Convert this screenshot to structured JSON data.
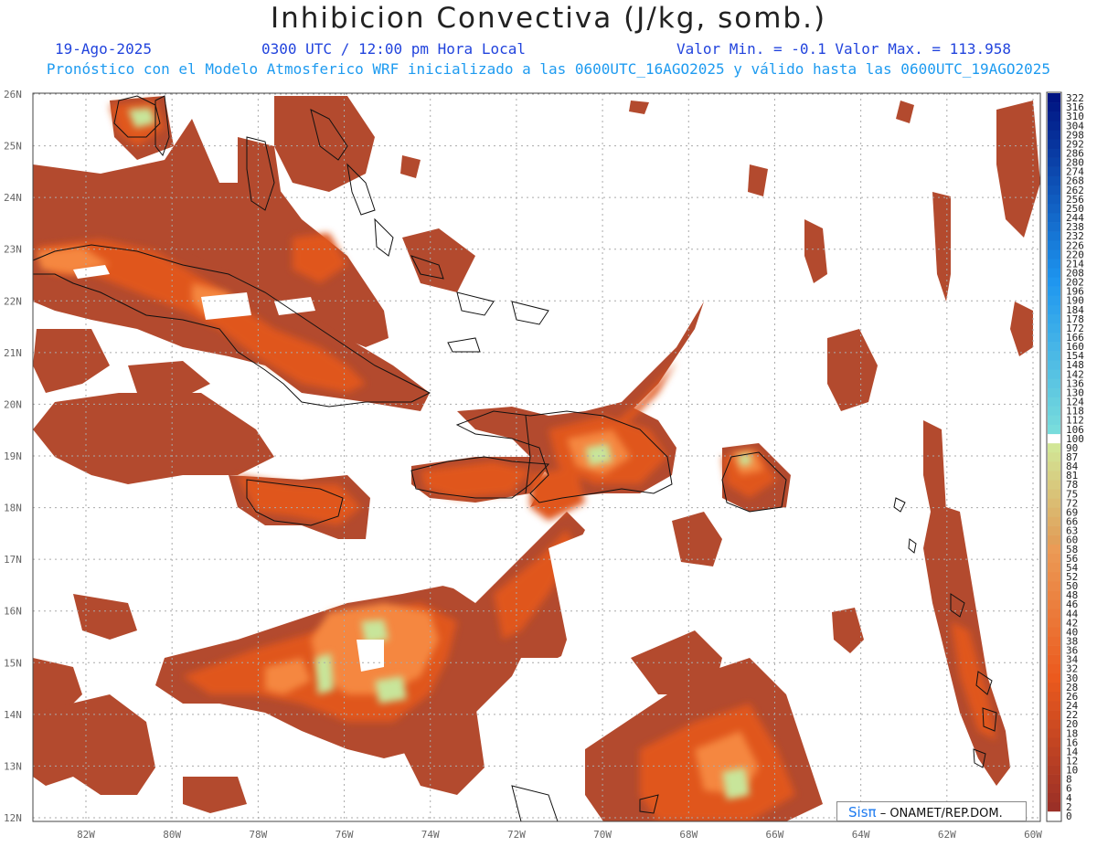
{
  "title": "Inhibicion Convectiva (J/kg, somb.)",
  "header": {
    "date": "19-Ago-2025",
    "time": "0300 UTC / 12:00 pm Hora Local",
    "min_max": "Valor Min. = -0.1  Valor Max. = 113.958",
    "subtitle": "Pronóstico con el Modelo Atmosferico WRF inicializado a las 0600UTC_16AGO2025 y válido hasta las  0600UTC_19AGO2025"
  },
  "map": {
    "lat_labels": [
      "26N",
      "25N",
      "24N",
      "23N",
      "22N",
      "21N",
      "20N",
      "19N",
      "18N",
      "17N",
      "16N",
      "15N",
      "14N",
      "13N",
      "12N"
    ],
    "lon_labels": [
      "82W",
      "80W",
      "78W",
      "76W",
      "74W",
      "72W",
      "70W",
      "68W",
      "66W",
      "64W",
      "62W",
      "60W"
    ],
    "field_colors": {
      "low": "#b8432c",
      "mid": "#e4571e",
      "high": "#f2803a",
      "peak": "#c6e89a"
    }
  },
  "colorbar": {
    "labels": [
      "322",
      "316",
      "310",
      "304",
      "298",
      "292",
      "286",
      "280",
      "274",
      "268",
      "262",
      "256",
      "250",
      "244",
      "238",
      "232",
      "226",
      "220",
      "214",
      "208",
      "202",
      "196",
      "190",
      "184",
      "178",
      "172",
      "166",
      "160",
      "154",
      "148",
      "142",
      "136",
      "130",
      "124",
      "118",
      "112",
      "106",
      "100",
      "90",
      "87",
      "84",
      "81",
      "78",
      "75",
      "72",
      "69",
      "66",
      "63",
      "60",
      "58",
      "56",
      "54",
      "52",
      "50",
      "48",
      "46",
      "44",
      "42",
      "40",
      "38",
      "36",
      "34",
      "32",
      "30",
      "28",
      "26",
      "24",
      "22",
      "20",
      "18",
      "16",
      "14",
      "12",
      "10",
      "8",
      "6",
      "4",
      "2",
      "0"
    ]
  },
  "credit": {
    "sis": "Sisπ",
    "text": "– ONAMET/REP.DOM."
  }
}
